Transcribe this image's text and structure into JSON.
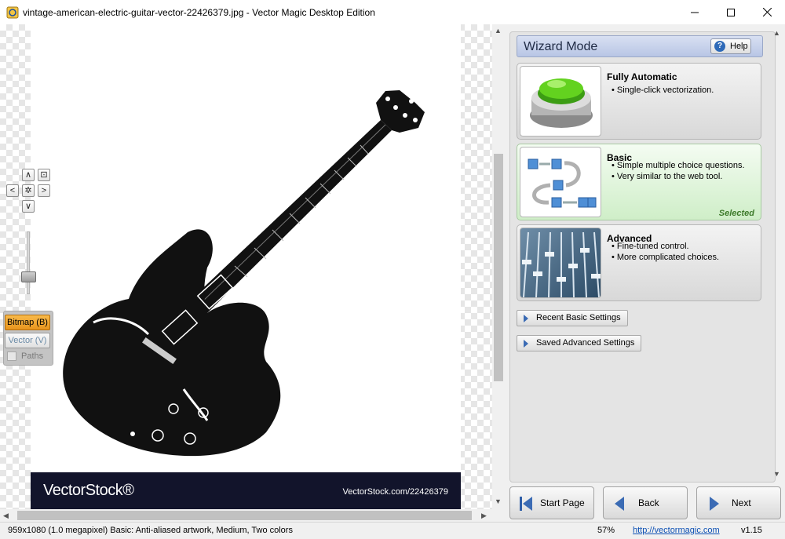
{
  "window": {
    "title": "vintage-american-electric-guitar-vector-22426379.jpg - Vector Magic Desktop Edition",
    "minimize_icon": "minimize-icon",
    "maximize_icon": "maximize-icon",
    "close_icon": "close-icon"
  },
  "canvas": {
    "banner_logo": "VectorStock®",
    "banner_url": "VectorStock.com/22426379",
    "nav": {
      "up": "∧",
      "down": "∨",
      "left": "<",
      "right": ">",
      "center": "✲",
      "fit": "⊡"
    },
    "modes": {
      "bitmap": "Bitmap (B)",
      "vector": "Vector (V)",
      "paths": "Paths"
    },
    "zoom_level": 0.3
  },
  "wizard": {
    "title": "Wizard Mode",
    "help_label": "Help",
    "options": [
      {
        "title": "Fully Automatic",
        "bullets": [
          "Single-click vectorization."
        ]
      },
      {
        "title": "Basic",
        "bullets": [
          "Simple multiple choice questions.",
          "Very similar to the web tool."
        ],
        "status": "Selected"
      },
      {
        "title": "Advanced",
        "bullets": [
          "Fine-tuned control.",
          "More complicated choices."
        ]
      }
    ],
    "recent_basic": "Recent Basic Settings",
    "saved_advanced": "Saved Advanced Settings"
  },
  "footer_buttons": {
    "start": "Start Page",
    "back": "Back",
    "next": "Next"
  },
  "status": {
    "image_info": "959x1080 (1.0 megapixel)  Basic: Anti-aliased artwork, Medium, Two colors",
    "zoom": "57%",
    "link": "http://vectormagic.com",
    "version": "v1.15"
  },
  "colors": {
    "accent": "#3b6bb4",
    "selected_bg": "#cfeec8",
    "bitmap_active": "#e8951d",
    "banner": "#12142b"
  }
}
